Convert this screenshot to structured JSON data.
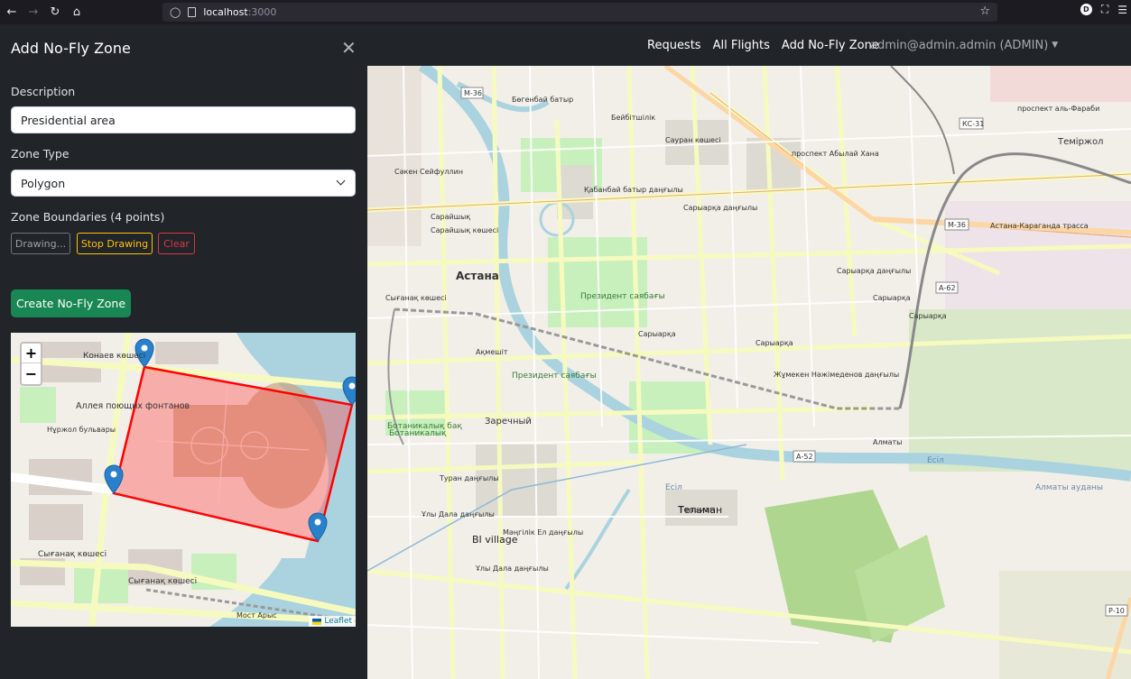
{
  "browser": {
    "url_host": "localhost",
    "url_port": ":3000",
    "extension_badge": "D"
  },
  "navbar": {
    "links": [
      "Requests",
      "All Flights",
      "Add No-Fly Zone"
    ],
    "user": "admin@admin.admin (ADMIN)"
  },
  "sidebar": {
    "title": "Add No-Fly Zone",
    "description_label": "Description",
    "description_value": "Presidential area",
    "zone_type_label": "Zone Type",
    "zone_type_value": "Polygon",
    "boundaries_label": "Zone Boundaries (4 points)",
    "drawing_button": "Drawing...",
    "stop_button": "Stop Drawing",
    "clear_button": "Clear",
    "create_button": "Create No-Fly Zone"
  },
  "minimap": {
    "zoom_in": "+",
    "zoom_out": "−",
    "attribution": "Leaflet",
    "labels": [
      "Конаев көшесі",
      "Аллея поющих фонтанов",
      "Нұржол бульвары",
      "Сығанақ көшесі",
      "Сығанақ көшесі",
      "Мост Арыс"
    ],
    "polygon_points": 4
  },
  "map": {
    "labels": [
      "Астана",
      "Президент саябағы",
      "Президент саябағы",
      "Ботаникалық бақ",
      "Заречный",
      "Сарайшық көшесі",
      "Ұлы Дала даңғылы",
      "Ұлы Дала даңғылы",
      "Сауран көшесі",
      "Туран даңғылы",
      "Мәңгілік Ел даңғылы",
      "Қабанбай батыр даңғылы",
      "Жұмекен Нәжімеденов даңғылы",
      "проспект Абылай Хана",
      "проспект аль-Фараби",
      "Астана-Караганда трасса",
      "Алматы ауданы",
      "Сарыарқа даңғылы",
      "Сарыарқа даңғылы",
      "Бөгенбай батыр",
      "Сәкен Сейфуллин",
      "Бейбітшілік",
      "Сарыарқа",
      "Есіл",
      "Есіл",
      "Тельман",
      "Тельман",
      "Теміржол",
      "Ботаникалық",
      "Сығанақ көшесі",
      "Алматы",
      "Сарайшық",
      "Ақмешіт",
      "BI village",
      "Сарыарқа",
      "Сарыарқа",
      "Сарыарқа"
    ],
    "shields": [
      "М-36",
      "КС-31",
      "М-36",
      "А-62",
      "А-52",
      "Р-10"
    ]
  }
}
